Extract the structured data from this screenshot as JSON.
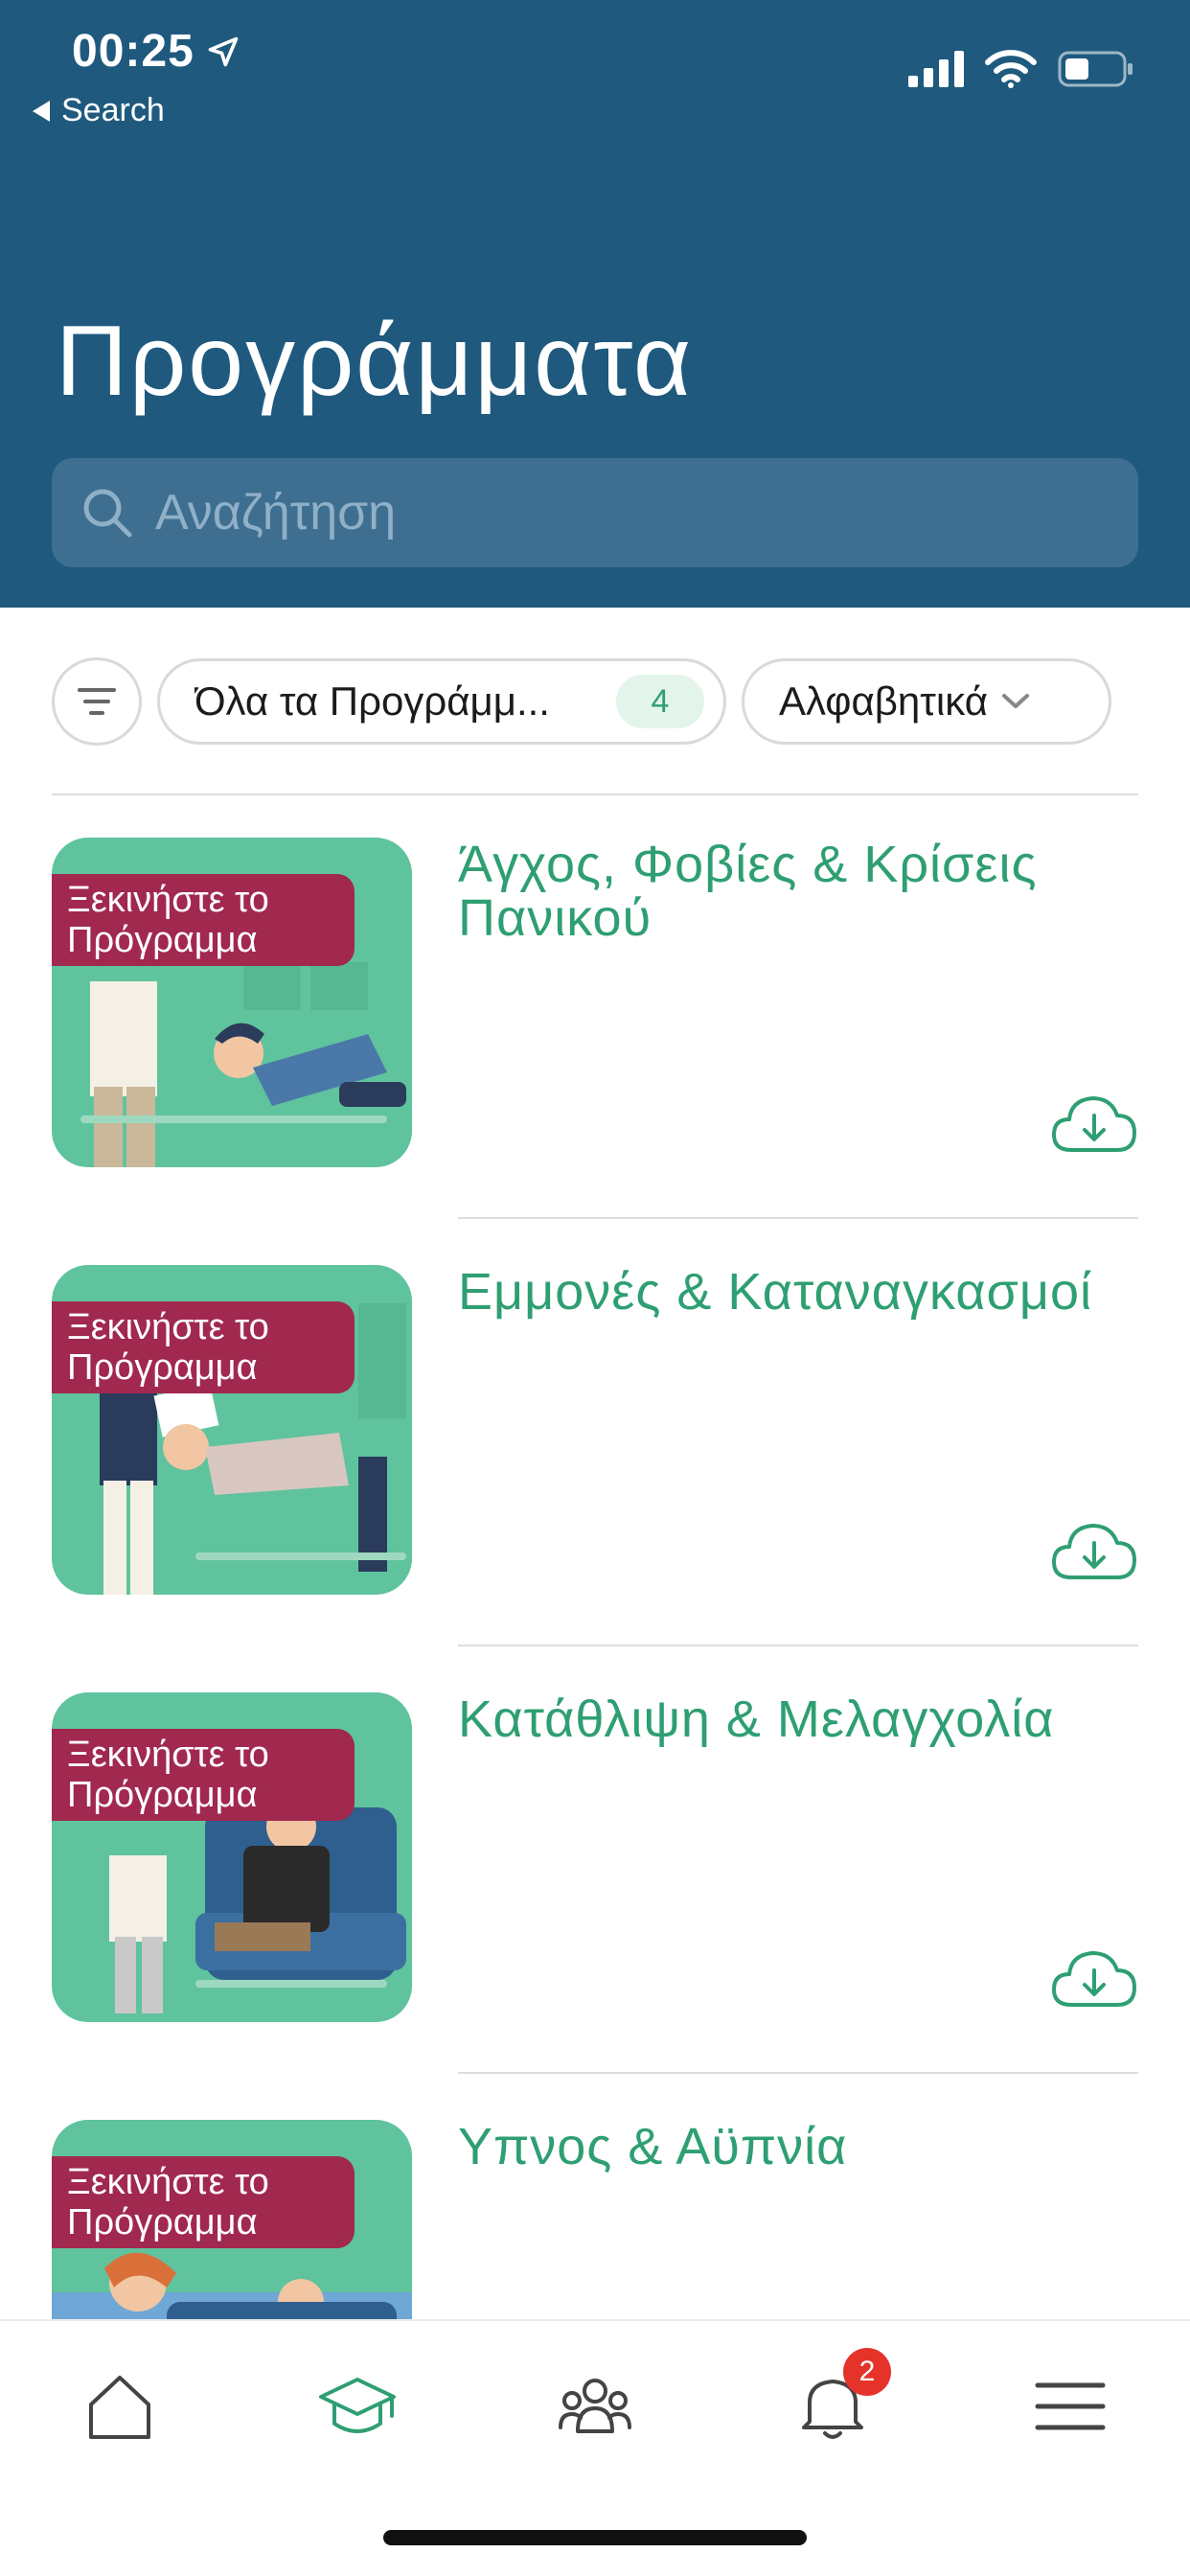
{
  "status_bar": {
    "time": "00:25",
    "back_label": "Search"
  },
  "header": {
    "title": "Προγράμματα"
  },
  "search": {
    "placeholder": "Αναζήτηση"
  },
  "filters": {
    "programs_label": "Όλα τα Προγράμμ...",
    "programs_count": "4",
    "sort_label": "Αλφαβητικά"
  },
  "programs": [
    {
      "title": "Άγχος, Φοβίες & Κρίσεις Πανικού",
      "badge": "Ξεκινήστε το Πρόγραμμα"
    },
    {
      "title": "Εμμονές & Καταναγκασμοί",
      "badge": "Ξεκινήστε το Πρόγραμμα"
    },
    {
      "title": "Κατάθλιψη & Μελαγχολία",
      "badge": "Ξεκινήστε το Πρόγραμμα"
    },
    {
      "title": "Υπνος & Αϋπνία",
      "badge": "Ξεκινήστε το Πρόγραμμα"
    }
  ],
  "tabbar": {
    "notifications_count": "2",
    "active_tab": "programs"
  },
  "colors": {
    "header": "#1f5a7e",
    "accent": "#2e9f72",
    "badge": "#a1284f",
    "thumb": "#5fc39e",
    "notification": "#e5332a"
  }
}
